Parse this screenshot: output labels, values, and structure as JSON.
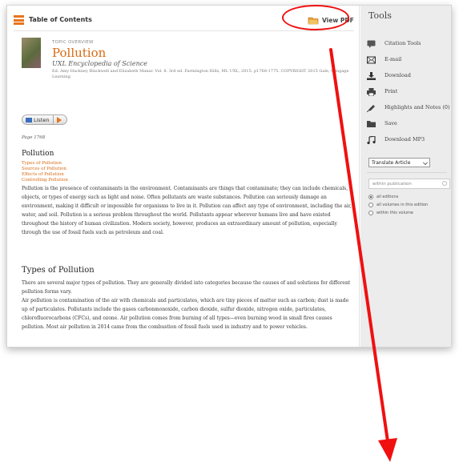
{
  "toolbar": {
    "toc_label": "Table of Contents",
    "view_pdf_label": "View PDF"
  },
  "article": {
    "topic_overview": "TOPIC OVERVIEW",
    "title": "Pollution",
    "source": "UXL Encyclopedia of Science",
    "citation": "Ed. Amy Hackney Blackwell and Elizabeth Manar. Vol. 8. 3rd ed. Farmington Hills, MI: UXL, 2015. p1768-1775. COPYRIGHT 2015 Gale, Cengage Learning",
    "listen_label": "Listen",
    "page_number": "Page 1768",
    "heading": "Pollution",
    "toc_links": [
      "Types of Pollution",
      "Sources of Pollution",
      "Effects of Pollution",
      "Controlling Pollution"
    ],
    "paragraph1": "Pollution is the presence of contaminants in the environment. Contaminants are things that contaminate; they can include chemicals, objects, or types of energy such as light and noise. Often pollutants are waste substances. Pollution can seriously damage an environment, making it difficult or impossible for organisms to live in it. Pollution can affect any type of environment, including the air, water, and soil. Pollution is a serious problem throughout the world. Pollutants appear wherever humans live and have existed throughout the history of human civilization. Modern society, however, produces an extraordinary amount of pollution, especially through the use of fossil fuels such as petroleum and coal.",
    "subheading": "Types of Pollution",
    "paragraph2": "There are several major types of pollution. They are generally divided into categories because the causes of and solutions for different pollution forms vary.",
    "paragraph3": "Air pollution is contamination of the air with chemicals and particulates, which are tiny pieces of matter such as carbon; dust is made up of particulates. Pollutants include the gases carbonmonoxide, carbon dioxide, sulfur dioxide, nitrogen oxide, particulates, chlorofluorocarbons (CFCs), and ozone. Air pollution comes from burning of all types—even burning wood in small fires causes pollution. Most air pollution in 2014 came from the combustion of fossil fuels used in industry and to power vehicles."
  },
  "sidebar": {
    "title": "Tools",
    "tools": [
      {
        "label": "Citation Tools",
        "icon": "citation-icon"
      },
      {
        "label": "E-mail",
        "icon": "email-icon"
      },
      {
        "label": "Download",
        "icon": "download-icon"
      },
      {
        "label": "Print",
        "icon": "print-icon"
      },
      {
        "label": "Highlights and Notes (0)",
        "icon": "highlight-icon"
      },
      {
        "label": "Save",
        "icon": "folder-icon"
      },
      {
        "label": "Download MP3",
        "icon": "music-note-icon"
      }
    ],
    "translate_label": "Translate Article",
    "search_placeholder": "within publication",
    "radio_options": [
      "all editions",
      "all volumes in this edition",
      "within this volume"
    ],
    "radio_selected": "all editions"
  },
  "colors": {
    "accent": "#d86a12",
    "annotation_red": "#f01010"
  }
}
